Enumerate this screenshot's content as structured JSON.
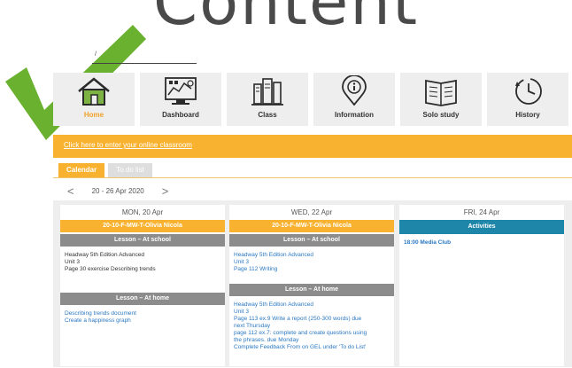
{
  "header": {
    "title_fragment": "Content",
    "small_mark": "/"
  },
  "nav_tiles": [
    {
      "label": "Home",
      "icon": "home-icon"
    },
    {
      "label": "Dashboard",
      "icon": "dashboard-icon"
    },
    {
      "label": "Class",
      "icon": "class-icon"
    },
    {
      "label": "Information",
      "icon": "information-icon"
    },
    {
      "label": "Solo study",
      "icon": "solo-study-icon"
    },
    {
      "label": "History",
      "icon": "history-icon"
    }
  ],
  "banner": {
    "link_text": "Click here to enter your online classroom"
  },
  "tabs": {
    "calendar": "Calendar",
    "todo": "To do list"
  },
  "date_nav": {
    "prev": "<",
    "range": "20 - 26 Apr 2020",
    "next": ">"
  },
  "columns": {
    "mon": {
      "day": "MON, 20 Apr",
      "class_name": "20-10-F-MW-T-Olivia Nicola",
      "school_header": "Lesson – At school",
      "school_lines": [
        "Headway 5th Edition Advanced",
        "Unit 3",
        "Page 30 exercise Describing trends"
      ],
      "home_header": "Lesson – At home",
      "home_lines": [
        "Describing trends document",
        "Create a happiness graph"
      ]
    },
    "wed": {
      "day": "WED, 22 Apr",
      "class_name": "20-10-F-MW-T-Olivia Nicola",
      "school_header": "Lesson – At school",
      "school_lines": [
        "Headway 5th Edition Advanced",
        "Unit 3",
        "Page 112 Writing"
      ],
      "home_header": "Lesson – At home",
      "home_lines": [
        "Headway 5th Edition Advanced",
        "Unit 3",
        "Page 113 ex.9 Write a report (250-300 words) due",
        "next Thursday",
        "page 112 ex.7: complete and create questions using",
        "the phrases. due Monday",
        "Complete Feedback From on GEL under 'To do List'"
      ]
    },
    "fri": {
      "day": "FRI, 24 Apr",
      "activities_header": "Activities",
      "activity": "18:00 Media Club"
    }
  },
  "colors": {
    "accent": "#f9b22f",
    "teal": "#1e86a9",
    "link": "#2a78c2",
    "check": "#69b12f"
  }
}
